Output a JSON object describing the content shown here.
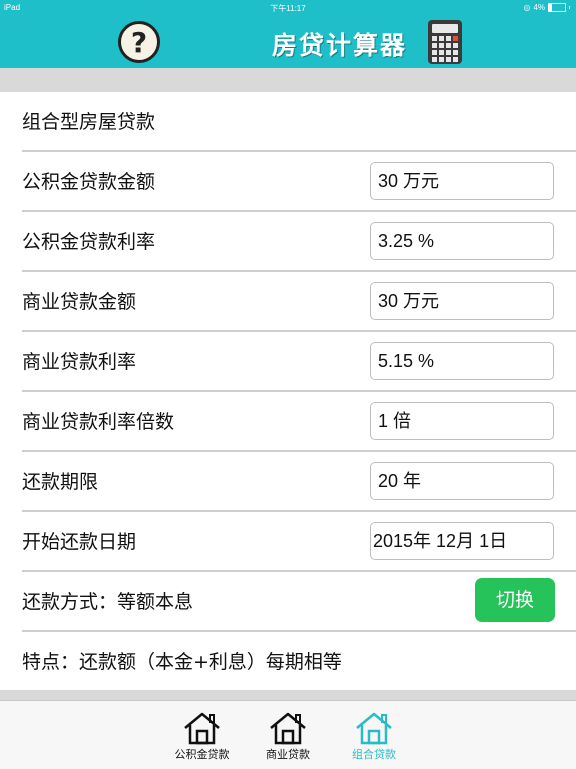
{
  "status_bar": {
    "device": "iPad",
    "time": "下午11:17",
    "battery": "4%"
  },
  "header": {
    "help_symbol": "?",
    "title": "房贷计算器",
    "calc_icon": "calculator-icon"
  },
  "form": {
    "section_title": "组合型房屋贷款",
    "rows": [
      {
        "label": "公积金贷款金额",
        "value": "30 万元"
      },
      {
        "label": "公积金贷款利率",
        "value": "3.25 %"
      },
      {
        "label": "商业贷款金额",
        "value": "30 万元"
      },
      {
        "label": "商业贷款利率",
        "value": "5.15 %"
      },
      {
        "label": "商业贷款利率倍数",
        "value": "1 倍"
      },
      {
        "label": "还款期限",
        "value": "20 年"
      },
      {
        "label": "开始还款日期",
        "value": "2015年 12月 1日"
      }
    ],
    "repay_method_label": "还款方式：等额本息",
    "switch_label": "切换",
    "feature_label": "特点：还款额（本金+利息）每期相等"
  },
  "tabs": [
    {
      "label": "公积金贷款",
      "icon": "house-icon",
      "active": false
    },
    {
      "label": "商业贷款",
      "icon": "house-icon",
      "active": false
    },
    {
      "label": "组合贷款",
      "icon": "house-icon",
      "active": true
    }
  ],
  "colors": {
    "header_bg": "#1fbfca",
    "switch_green": "#26c35a",
    "tab_active": "#29bcc8"
  }
}
